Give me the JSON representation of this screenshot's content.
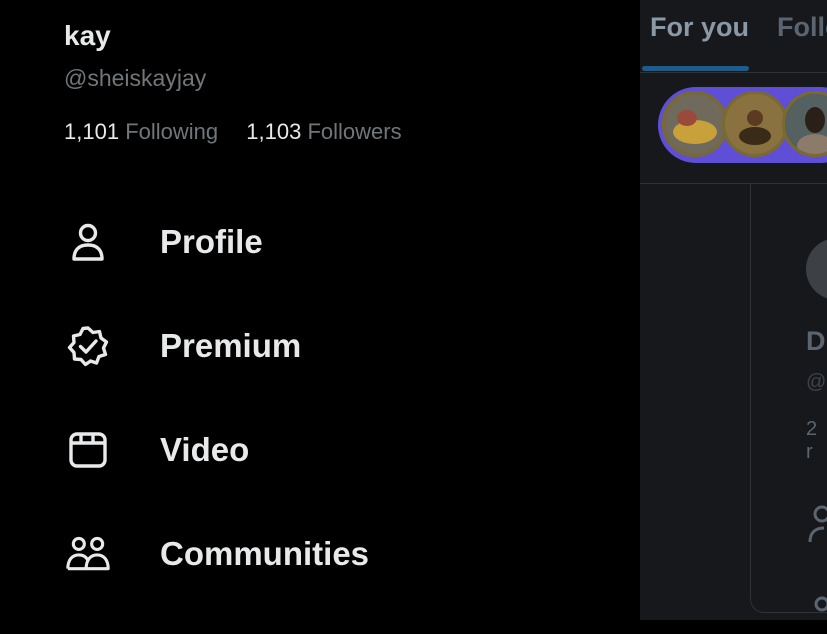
{
  "profile": {
    "name": "kay",
    "handle": "@sheiskayjay",
    "following_count": "1,101",
    "following_label": "Following",
    "followers_count": "1,103",
    "followers_label": "Followers"
  },
  "nav": {
    "items": [
      {
        "label": "Profile",
        "icon": "person-icon"
      },
      {
        "label": "Premium",
        "icon": "verified-badge-icon"
      },
      {
        "label": "Video",
        "icon": "video-clapper-icon"
      },
      {
        "label": "Communities",
        "icon": "communities-icon"
      }
    ]
  },
  "timeline": {
    "tabs": [
      "For you",
      "Follo"
    ],
    "active_tab": "For you",
    "card": {
      "initial": "D",
      "handle_fragment": "@",
      "count_fragment": "2 r"
    }
  },
  "colors": {
    "background": "#000000",
    "text_primary": "#e7e9ea",
    "text_secondary": "#71767b",
    "panel_background": "#16181c",
    "tab_indicator": "#1f5b86",
    "stories_pill": "#5f4fd6"
  }
}
